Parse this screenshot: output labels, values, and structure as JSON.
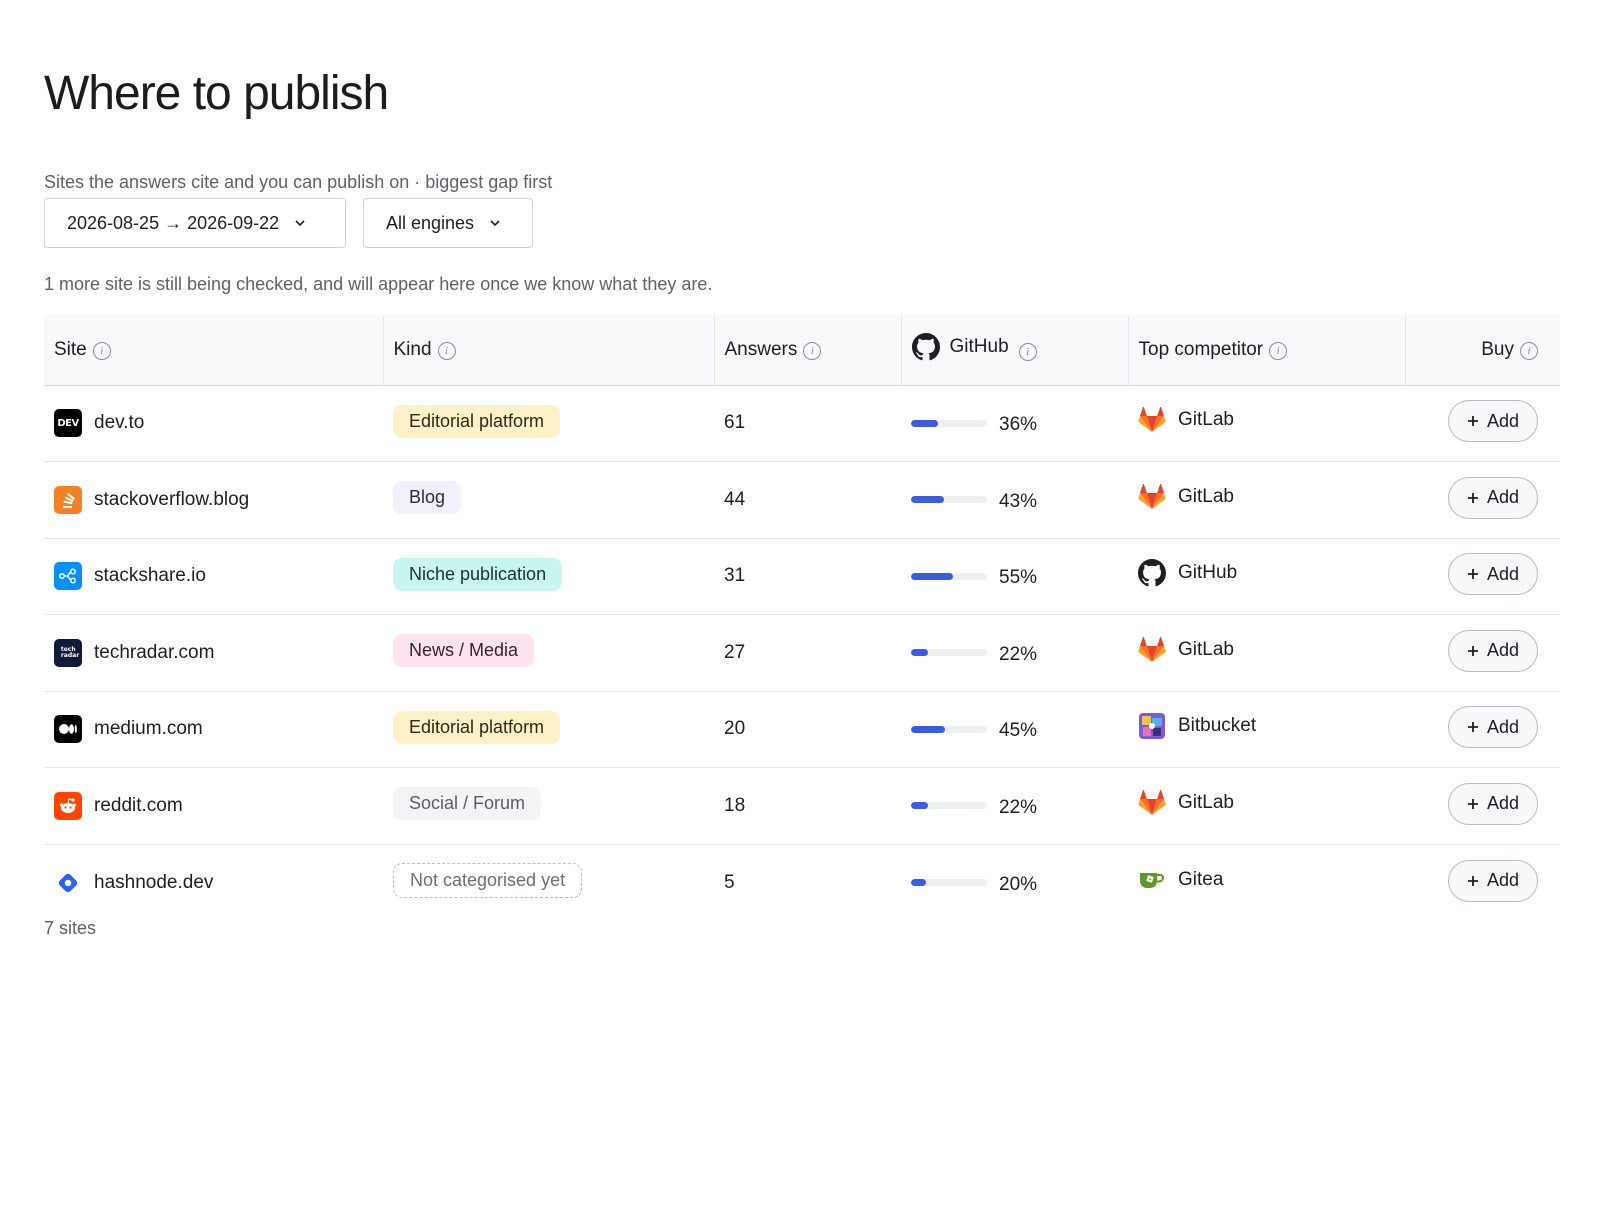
{
  "page": {
    "title": "Where to publish",
    "subtitle": "Sites the answers cite and you can publish on · biggest gap first",
    "notice": "1 more site is still being checked, and will appear here once we know what they are.",
    "footer": "7 sites"
  },
  "filters": {
    "date_range": "2026-08-25 → 2026-09-22",
    "engine": "All engines"
  },
  "table": {
    "headers": {
      "site": "Site",
      "kind": "Kind",
      "answers": "Answers",
      "brand": "GitHub",
      "competitor": "Top competitor",
      "buy": "Buy"
    },
    "add_label": "Add",
    "rows": [
      {
        "site": "dev.to",
        "site_icon": "devto-logo",
        "kind": "Editorial platform",
        "kind_style": "editorial",
        "answers": "61",
        "share": 0.36,
        "share_label": "36%",
        "competitor": "GitLab",
        "competitor_icon": "gitlab-logo"
      },
      {
        "site": "stackoverflow.blog",
        "site_icon": "stackoverflow-logo",
        "kind": "Blog",
        "kind_style": "blog",
        "answers": "44",
        "share": 0.43,
        "share_label": "43%",
        "competitor": "GitLab",
        "competitor_icon": "gitlab-logo"
      },
      {
        "site": "stackshare.io",
        "site_icon": "stackshare-logo",
        "kind": "Niche publication",
        "kind_style": "niche",
        "answers": "31",
        "share": 0.55,
        "share_label": "55%",
        "competitor": "GitHub",
        "competitor_icon": "github-logo"
      },
      {
        "site": "techradar.com",
        "site_icon": "techradar-logo",
        "kind": "News / Media",
        "kind_style": "news",
        "answers": "27",
        "share": 0.22,
        "share_label": "22%",
        "competitor": "GitLab",
        "competitor_icon": "gitlab-logo"
      },
      {
        "site": "medium.com",
        "site_icon": "medium-logo",
        "kind": "Editorial platform",
        "kind_style": "editorial",
        "answers": "20",
        "share": 0.45,
        "share_label": "45%",
        "competitor": "Bitbucket",
        "competitor_icon": "bitbucket-logo"
      },
      {
        "site": "reddit.com",
        "site_icon": "reddit-logo",
        "kind": "Social / Forum",
        "kind_style": "social",
        "answers": "18",
        "share": 0.22,
        "share_label": "22%",
        "competitor": "GitLab",
        "competitor_icon": "gitlab-logo"
      },
      {
        "site": "hashnode.dev",
        "site_icon": "hashnode-logo",
        "kind": "Not categorised yet",
        "kind_style": "uncat",
        "answers": "5",
        "share": 0.2,
        "share_label": "20%",
        "competitor": "Gitea",
        "competitor_icon": "gitea-logo"
      }
    ]
  },
  "colors": {
    "bar_fill": "#3c5ce0",
    "gitlab": "#e24329",
    "stackoverflow": "#f48024",
    "stackshare": "#0690fa",
    "reddit": "#ff4500",
    "hashnode": "#2962ff",
    "gitea": "#609926"
  }
}
